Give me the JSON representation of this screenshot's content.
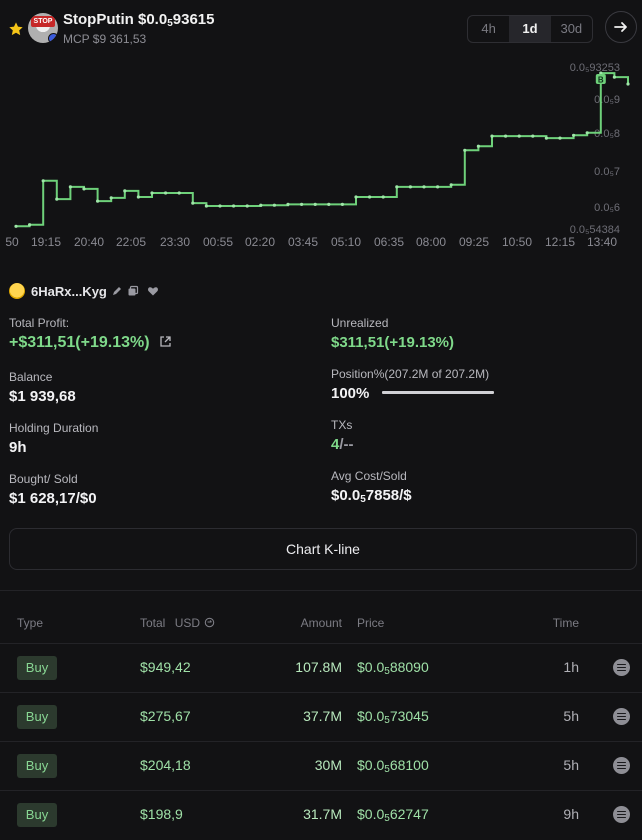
{
  "token": {
    "name": "StopPutin",
    "price_prefix": "$0.0",
    "price_sub": "5",
    "price_rest": "93615",
    "mcp": "MCP $9 361,53",
    "avatar_text": "STOP"
  },
  "timeframes": [
    {
      "label": "4h",
      "active": false
    },
    {
      "label": "1d",
      "active": true
    },
    {
      "label": "30d",
      "active": false
    }
  ],
  "icons": {
    "favorite": "star-icon",
    "next": "arrow-right-icon",
    "edit": "pencil-icon",
    "copy": "copy-icon",
    "watch": "heart-icon",
    "share": "external-link-icon",
    "refresh": "refresh-icon",
    "row_menu": "menu-icon"
  },
  "colors": {
    "accent_green": "#7fd98a",
    "line": "#6ed17a",
    "buy_tag_bg": "#2c3a2e"
  },
  "chart_data": {
    "type": "line",
    "x_tick_labels": [
      "50",
      "19:15",
      "20:40",
      "22:05",
      "23:30",
      "00:55",
      "02:20",
      "03:45",
      "05:10",
      "06:35",
      "08:00",
      "09:25",
      "10:50",
      "12:15",
      "13:40"
    ],
    "y_tick_labels": [
      "0.0₅93253",
      "0.0₅9",
      "0.0₅8",
      "0.0₅7",
      "0.0₅6",
      "0.0₅54384"
    ],
    "ylim": [
      5.4384e-07,
      9.3253e-07
    ],
    "x": [
      0,
      1,
      2,
      3,
      4,
      5,
      6,
      7,
      8,
      9,
      10,
      11,
      12,
      13,
      14,
      15,
      16,
      17,
      18,
      19,
      20,
      21,
      22,
      23,
      24,
      25,
      26,
      27,
      28,
      29,
      30,
      31,
      32,
      33,
      34,
      35,
      36,
      37,
      38,
      39,
      40,
      41,
      42,
      43,
      44,
      45
    ],
    "y": [
      5.48e-07,
      5.52e-07,
      6.6e-07,
      6.15e-07,
      6.45e-07,
      6.4e-07,
      6.1e-07,
      6.18e-07,
      6.35e-07,
      6.2e-07,
      6.3e-07,
      6.3e-07,
      6.3e-07,
      6.05e-07,
      5.98e-07,
      5.98e-07,
      5.98e-07,
      5.98e-07,
      6e-07,
      6e-07,
      6.02e-07,
      6.02e-07,
      6.02e-07,
      6.02e-07,
      6.02e-07,
      6.2e-07,
      6.2e-07,
      6.2e-07,
      6.45e-07,
      6.45e-07,
      6.45e-07,
      6.45e-07,
      6.5e-07,
      7.35e-07,
      7.45e-07,
      7.7e-07,
      7.7e-07,
      7.7e-07,
      7.7e-07,
      7.65e-07,
      7.65e-07,
      7.72e-07,
      7.78e-07,
      9.25e-07,
      9.15e-07,
      8.98e-07
    ],
    "markers": [
      {
        "label": "B",
        "x": 43
      }
    ],
    "grid": false,
    "legend": "none"
  },
  "wallet": {
    "name": "6HaRx...Kyg"
  },
  "stats": {
    "total_profit_label": "Total Profit:",
    "total_profit_value": "+$311,51(+19.13%)",
    "unrealized_label": "Unrealized",
    "unrealized_value": "$311,51(+19.13%)",
    "balance_label": "Balance",
    "balance_value": "$1 939,68",
    "position_label": "Position%(207.2M of 207.2M)",
    "position_value": "100%",
    "position_fraction": 1.0,
    "holding_label": "Holding Duration",
    "holding_value": "9h",
    "txs_label": "TXs",
    "txs_buys": "4",
    "txs_sells": "/--",
    "bought_label": "Bought/ Sold",
    "bought_value": "$1 628,17/$0",
    "avg_label": "Avg Cost/Sold",
    "avg_prefix": "$0.0",
    "avg_sub": "5",
    "avg_rest": "7858/$"
  },
  "kline_button": "Chart K-line",
  "table": {
    "headers": {
      "type": "Type",
      "total": "Total",
      "usd": "USD",
      "amount": "Amount",
      "price": "Price",
      "time": "Time"
    },
    "rows": [
      {
        "type": "Buy",
        "total": "$949,42",
        "amount": "107.8M",
        "price_prefix": "$0.0",
        "price_sub": "5",
        "price_rest": "88090",
        "time": "1h"
      },
      {
        "type": "Buy",
        "total": "$275,67",
        "amount": "37.7M",
        "price_prefix": "$0.0",
        "price_sub": "5",
        "price_rest": "73045",
        "time": "5h"
      },
      {
        "type": "Buy",
        "total": "$204,18",
        "amount": "30M",
        "price_prefix": "$0.0",
        "price_sub": "5",
        "price_rest": "68100",
        "time": "5h"
      },
      {
        "type": "Buy",
        "total": "$198,9",
        "amount": "31.7M",
        "price_prefix": "$0.0",
        "price_sub": "5",
        "price_rest": "62747",
        "time": "9h"
      }
    ]
  }
}
